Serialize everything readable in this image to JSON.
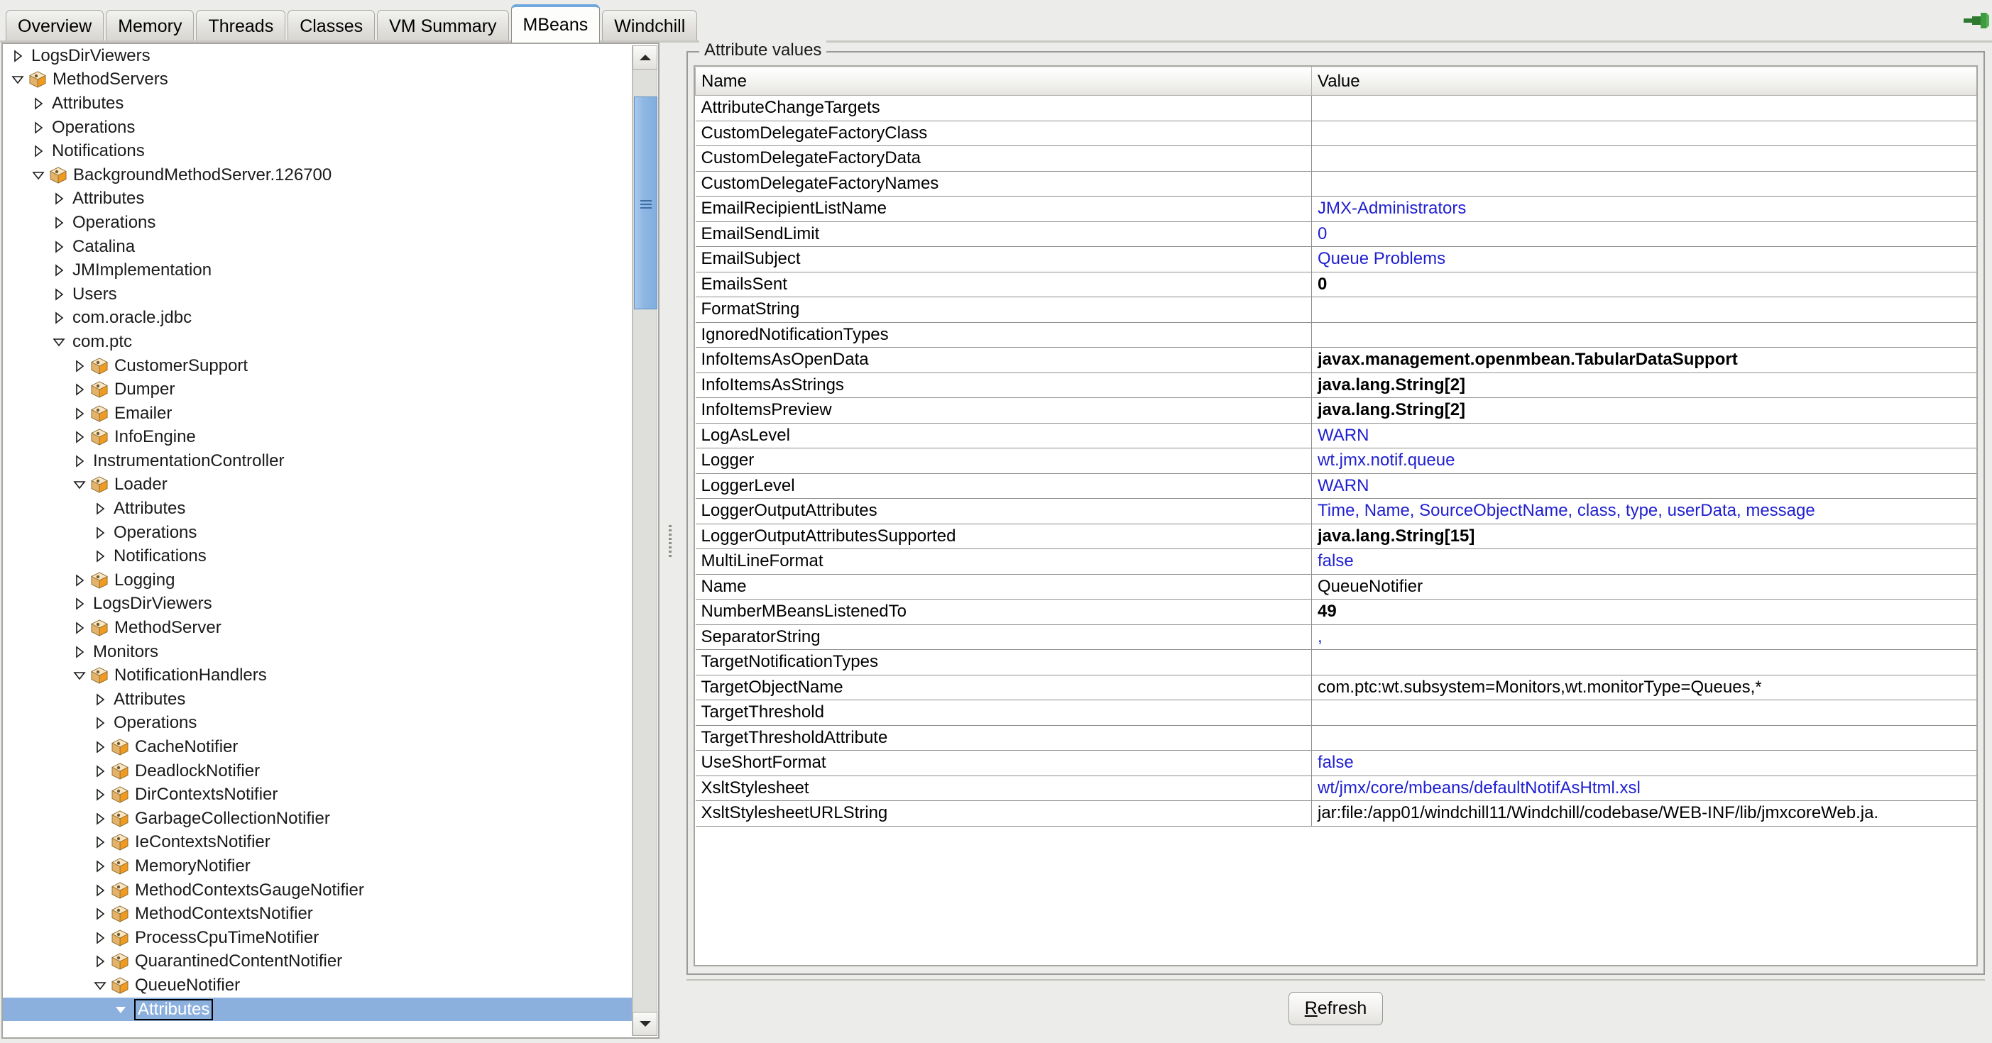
{
  "window": {
    "pin_icon": "pin-icon"
  },
  "tabs": [
    {
      "label": "Overview",
      "selected": false
    },
    {
      "label": "Memory",
      "selected": false
    },
    {
      "label": "Threads",
      "selected": false
    },
    {
      "label": "Classes",
      "selected": false
    },
    {
      "label": "VM Summary",
      "selected": false
    },
    {
      "label": "MBeans",
      "selected": true
    },
    {
      "label": "Windchill",
      "selected": false
    }
  ],
  "tree": {
    "rows": [
      {
        "label": "LogsDirViewers",
        "indent": 1,
        "twisty": "collapsed",
        "icon": false,
        "selected": false
      },
      {
        "label": "MethodServers",
        "indent": 1,
        "twisty": "expanded",
        "icon": true,
        "selected": false
      },
      {
        "label": "Attributes",
        "indent": 2,
        "twisty": "collapsed",
        "icon": false,
        "selected": false
      },
      {
        "label": "Operations",
        "indent": 2,
        "twisty": "collapsed",
        "icon": false,
        "selected": false
      },
      {
        "label": "Notifications",
        "indent": 2,
        "twisty": "collapsed",
        "icon": false,
        "selected": false
      },
      {
        "label": "BackgroundMethodServer.126700",
        "indent": 2,
        "twisty": "expanded",
        "icon": true,
        "selected": false
      },
      {
        "label": "Attributes",
        "indent": 3,
        "twisty": "collapsed",
        "icon": false,
        "selected": false
      },
      {
        "label": "Operations",
        "indent": 3,
        "twisty": "collapsed",
        "icon": false,
        "selected": false
      },
      {
        "label": "Catalina",
        "indent": 3,
        "twisty": "collapsed",
        "icon": false,
        "selected": false
      },
      {
        "label": "JMImplementation",
        "indent": 3,
        "twisty": "collapsed",
        "icon": false,
        "selected": false
      },
      {
        "label": "Users",
        "indent": 3,
        "twisty": "collapsed",
        "icon": false,
        "selected": false
      },
      {
        "label": "com.oracle.jdbc",
        "indent": 3,
        "twisty": "collapsed",
        "icon": false,
        "selected": false
      },
      {
        "label": "com.ptc",
        "indent": 3,
        "twisty": "expanded",
        "icon": false,
        "selected": false
      },
      {
        "label": "CustomerSupport",
        "indent": 4,
        "twisty": "collapsed",
        "icon": true,
        "selected": false
      },
      {
        "label": "Dumper",
        "indent": 4,
        "twisty": "collapsed",
        "icon": true,
        "selected": false
      },
      {
        "label": "Emailer",
        "indent": 4,
        "twisty": "collapsed",
        "icon": true,
        "selected": false
      },
      {
        "label": "InfoEngine",
        "indent": 4,
        "twisty": "collapsed",
        "icon": true,
        "selected": false
      },
      {
        "label": "InstrumentationController",
        "indent": 4,
        "twisty": "collapsed",
        "icon": false,
        "selected": false
      },
      {
        "label": "Loader",
        "indent": 4,
        "twisty": "expanded",
        "icon": true,
        "selected": false
      },
      {
        "label": "Attributes",
        "indent": 5,
        "twisty": "collapsed",
        "icon": false,
        "selected": false
      },
      {
        "label": "Operations",
        "indent": 5,
        "twisty": "collapsed",
        "icon": false,
        "selected": false
      },
      {
        "label": "Notifications",
        "indent": 5,
        "twisty": "collapsed",
        "icon": false,
        "selected": false
      },
      {
        "label": "Logging",
        "indent": 4,
        "twisty": "collapsed",
        "icon": true,
        "selected": false
      },
      {
        "label": "LogsDirViewers",
        "indent": 4,
        "twisty": "collapsed",
        "icon": false,
        "selected": false
      },
      {
        "label": "MethodServer",
        "indent": 4,
        "twisty": "collapsed",
        "icon": true,
        "selected": false
      },
      {
        "label": "Monitors",
        "indent": 4,
        "twisty": "collapsed",
        "icon": false,
        "selected": false
      },
      {
        "label": "NotificationHandlers",
        "indent": 4,
        "twisty": "expanded",
        "icon": true,
        "selected": false
      },
      {
        "label": "Attributes",
        "indent": 5,
        "twisty": "collapsed",
        "icon": false,
        "selected": false
      },
      {
        "label": "Operations",
        "indent": 5,
        "twisty": "collapsed",
        "icon": false,
        "selected": false
      },
      {
        "label": "CacheNotifier",
        "indent": 5,
        "twisty": "collapsed",
        "icon": true,
        "selected": false
      },
      {
        "label": "DeadlockNotifier",
        "indent": 5,
        "twisty": "collapsed",
        "icon": true,
        "selected": false
      },
      {
        "label": "DirContextsNotifier",
        "indent": 5,
        "twisty": "collapsed",
        "icon": true,
        "selected": false
      },
      {
        "label": "GarbageCollectionNotifier",
        "indent": 5,
        "twisty": "collapsed",
        "icon": true,
        "selected": false
      },
      {
        "label": "IeContextsNotifier",
        "indent": 5,
        "twisty": "collapsed",
        "icon": true,
        "selected": false
      },
      {
        "label": "MemoryNotifier",
        "indent": 5,
        "twisty": "collapsed",
        "icon": true,
        "selected": false
      },
      {
        "label": "MethodContextsGaugeNotifier",
        "indent": 5,
        "twisty": "collapsed",
        "icon": true,
        "selected": false
      },
      {
        "label": "MethodContextsNotifier",
        "indent": 5,
        "twisty": "collapsed",
        "icon": true,
        "selected": false
      },
      {
        "label": "ProcessCpuTimeNotifier",
        "indent": 5,
        "twisty": "collapsed",
        "icon": true,
        "selected": false
      },
      {
        "label": "QuarantinedContentNotifier",
        "indent": 5,
        "twisty": "collapsed",
        "icon": true,
        "selected": false
      },
      {
        "label": "QueueNotifier",
        "indent": 5,
        "twisty": "expanded",
        "icon": true,
        "selected": false
      },
      {
        "label": "Attributes",
        "indent": 6,
        "twisty": "expanded-solid",
        "icon": false,
        "selected": true
      }
    ]
  },
  "attributes_panel": {
    "group_title": "Attribute values",
    "columns": [
      "Name",
      "Value"
    ],
    "refresh_label_prefix": "R",
    "refresh_label_rest": "efresh",
    "rows": [
      {
        "name": "AttributeChangeTargets",
        "value": "",
        "style": "v-plain"
      },
      {
        "name": "CustomDelegateFactoryClass",
        "value": "",
        "style": "v-plain"
      },
      {
        "name": "CustomDelegateFactoryData",
        "value": "",
        "style": "v-plain"
      },
      {
        "name": "CustomDelegateFactoryNames",
        "value": "",
        "style": "v-plain"
      },
      {
        "name": "EmailRecipientListName",
        "value": "JMX-Administrators",
        "style": "v-blue"
      },
      {
        "name": "EmailSendLimit",
        "value": "0",
        "style": "v-blue"
      },
      {
        "name": "EmailSubject",
        "value": "Queue Problems",
        "style": "v-blue"
      },
      {
        "name": "EmailsSent",
        "value": "0",
        "style": "v-bold"
      },
      {
        "name": "FormatString",
        "value": "",
        "style": "v-plain"
      },
      {
        "name": "IgnoredNotificationTypes",
        "value": "",
        "style": "v-plain"
      },
      {
        "name": "InfoItemsAsOpenData",
        "value": "javax.management.openmbean.TabularDataSupport",
        "style": "v-bold"
      },
      {
        "name": "InfoItemsAsStrings",
        "value": "java.lang.String[2]",
        "style": "v-bold"
      },
      {
        "name": "InfoItemsPreview",
        "value": "java.lang.String[2]",
        "style": "v-bold"
      },
      {
        "name": "LogAsLevel",
        "value": "WARN",
        "style": "v-blue"
      },
      {
        "name": "Logger",
        "value": "wt.jmx.notif.queue",
        "style": "v-blue"
      },
      {
        "name": "LoggerLevel",
        "value": "WARN",
        "style": "v-blue"
      },
      {
        "name": "LoggerOutputAttributes",
        "value": "Time, Name, SourceObjectName, class, type, userData, message",
        "style": "v-blue"
      },
      {
        "name": "LoggerOutputAttributesSupported",
        "value": "java.lang.String[15]",
        "style": "v-bold"
      },
      {
        "name": "MultiLineFormat",
        "value": "false",
        "style": "v-blue"
      },
      {
        "name": "Name",
        "value": "QueueNotifier",
        "style": "v-plain"
      },
      {
        "name": "NumberMBeansListenedTo",
        "value": "49",
        "style": "v-bold"
      },
      {
        "name": "SeparatorString",
        "value": ",",
        "style": "v-blue"
      },
      {
        "name": "TargetNotificationTypes",
        "value": "",
        "style": "v-plain"
      },
      {
        "name": "TargetObjectName",
        "value": "com.ptc:wt.subsystem=Monitors,wt.monitorType=Queues,*",
        "style": "v-plain"
      },
      {
        "name": "TargetThreshold",
        "value": "",
        "style": "v-plain"
      },
      {
        "name": "TargetThresholdAttribute",
        "value": "",
        "style": "v-plain"
      },
      {
        "name": "UseShortFormat",
        "value": "false",
        "style": "v-blue"
      },
      {
        "name": "XsltStylesheet",
        "value": "wt/jmx/core/mbeans/defaultNotifAsHtml.xsl",
        "style": "v-blue"
      },
      {
        "name": "XsltStylesheetURLString",
        "value": "jar:file:/app01/windchill11/Windchill/codebase/WEB-INF/lib/jmxcoreWeb.ja.",
        "style": "v-plain"
      }
    ]
  }
}
